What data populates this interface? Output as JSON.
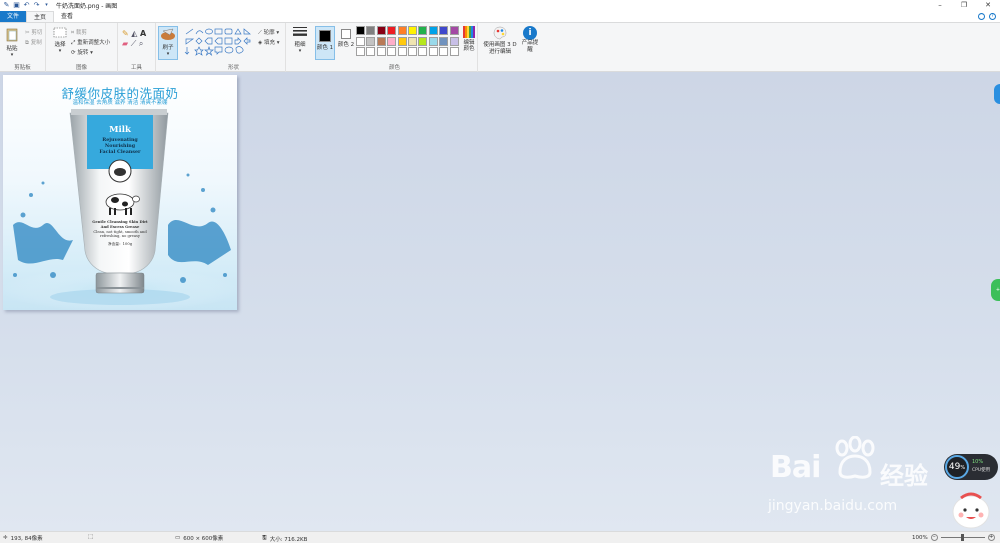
{
  "app": {
    "title": "牛奶洗面奶.png - 画图"
  },
  "tabs": [
    {
      "label": "文件"
    },
    {
      "label": "主页"
    },
    {
      "label": "查看"
    }
  ],
  "ribbon": {
    "clipboard": {
      "paste": "粘贴",
      "cut": "剪切",
      "copy": "复制",
      "group": "剪贴板"
    },
    "image": {
      "select": "选择",
      "crop": "裁剪",
      "resize": "重新调整大小",
      "rotate": "旋转",
      "group": "图像"
    },
    "tools": {
      "group": "工具",
      "text_tool": "A"
    },
    "brushes": {
      "label": "刷子"
    },
    "shapes": {
      "outline": "轮廓",
      "fill": "填充",
      "group": "形状"
    },
    "size": {
      "label": "粗细"
    },
    "colors": {
      "color1": "颜色 1",
      "color2": "颜色 2",
      "edit": "编辑颜色",
      "group": "颜色",
      "color1_value": "#000000",
      "color2_value": "#ffffff",
      "palette_row1": [
        "#000000",
        "#7f7f7f",
        "#880015",
        "#ed1c24",
        "#ff7f27",
        "#fff200",
        "#22b14c",
        "#00a2e8",
        "#3f48cc",
        "#a349a4"
      ],
      "palette_row2": [
        "#ffffff",
        "#c3c3c3",
        "#b97a57",
        "#ffaec9",
        "#ffc90e",
        "#efe4b0",
        "#b5e61d",
        "#99d9ea",
        "#7092be",
        "#c8bfe7"
      ],
      "palette_row3": [
        "#ffffff",
        "#ffffff",
        "#ffffff",
        "#ffffff",
        "#ffffff",
        "#ffffff",
        "#ffffff",
        "#ffffff",
        "#ffffff",
        "#ffffff"
      ]
    },
    "paint3d": {
      "label": "使用画图 3 D 进行编辑"
    },
    "product_alert": {
      "label": "产品提醒"
    }
  },
  "canvas_image": {
    "headline": "舒缓你皮肤的洗面奶",
    "tagline": "温和保湿  去角质  滋养  清洁  清爽不紧绷",
    "product": {
      "brand": "Milk",
      "line1": "Rejuvenating",
      "line2": "Nourishing",
      "line3": "Facial Cleanser",
      "desc1": "Gentle Cleansing Skin Dirt",
      "desc2": "And Excess Grease",
      "desc3": "Clean, not tight, smooth and",
      "desc4": "refreshing, no greasy",
      "net": "净含量：100g"
    }
  },
  "status": {
    "cursor": "193, 84像素",
    "dimensions": "600 × 600像素",
    "filesize": "大小: 716.2KB",
    "zoom": "100%"
  },
  "overlay": {
    "cpu_percent": "49",
    "cpu_unit": "%",
    "cpu_small": "10%",
    "cpu_label": "CPU使用",
    "watermark_brand": "Bai",
    "watermark_cn": "经验",
    "watermark_url": "jingyan.baidu.com"
  }
}
